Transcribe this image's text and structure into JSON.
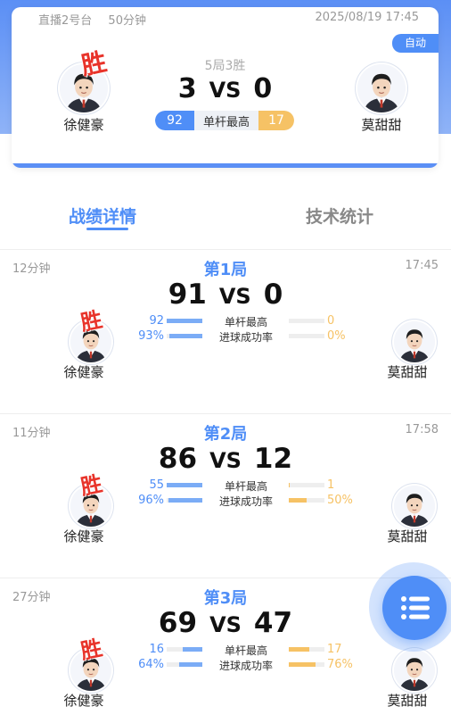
{
  "header": {
    "table": "直播2号台",
    "duration": "50分钟",
    "datetime": "2025/08/19 17:45",
    "auto_label": "自动",
    "format": "5局3胜",
    "score_left": "3",
    "score_right": "0",
    "vs": "VS",
    "highest_label": "单杆最高",
    "highest_left": "92",
    "highest_right": "17",
    "win_label": "胜",
    "player_left": "徐健豪",
    "player_right": "莫甜甜"
  },
  "tabs": {
    "active": "战绩详情",
    "inactive": "技术统计"
  },
  "games": [
    {
      "duration": "12分钟",
      "title": "第1局",
      "time": "17:45",
      "score_left": "91",
      "vs": "VS",
      "score_right": "0",
      "win_label": "胜",
      "player_left": "徐健豪",
      "player_right": "莫甜甜",
      "stat1_label": "单杆最高",
      "stat1_left": "92",
      "stat1_right": "0",
      "stat2_label": "进球成功率",
      "stat2_left": "93%",
      "stat2_right": "0%",
      "stat1_left_ratio": 1.0,
      "stat1_right_ratio": 0.0,
      "stat2_left_ratio": 0.93,
      "stat2_right_ratio": 0.0
    },
    {
      "duration": "11分钟",
      "title": "第2局",
      "time": "17:58",
      "score_left": "86",
      "vs": "VS",
      "score_right": "12",
      "win_label": "胜",
      "player_left": "徐健豪",
      "player_right": "莫甜甜",
      "stat1_label": "单杆最高",
      "stat1_left": "55",
      "stat1_right": "1",
      "stat2_label": "进球成功率",
      "stat2_left": "96%",
      "stat2_right": "50%",
      "stat1_left_ratio": 1.0,
      "stat1_right_ratio": 0.03,
      "stat2_left_ratio": 0.96,
      "stat2_right_ratio": 0.5
    },
    {
      "duration": "27分钟",
      "title": "第3局",
      "time": "",
      "score_left": "69",
      "vs": "VS",
      "score_right": "47",
      "win_label": "胜",
      "player_left": "徐健豪",
      "player_right": "莫甜甜",
      "stat1_label": "单杆最高",
      "stat1_left": "16",
      "stat1_right": "17",
      "stat2_label": "进球成功率",
      "stat2_left": "64%",
      "stat2_right": "76%",
      "stat1_left_ratio": 0.55,
      "stat1_right_ratio": 0.58,
      "stat2_left_ratio": 0.64,
      "stat2_right_ratio": 0.76
    }
  ],
  "icons": {
    "fab": "list-icon",
    "avatar": "avatar-icon"
  },
  "colors": {
    "primary": "#4f8ef7",
    "secondary": "#f6c265",
    "win": "#e8332a"
  }
}
